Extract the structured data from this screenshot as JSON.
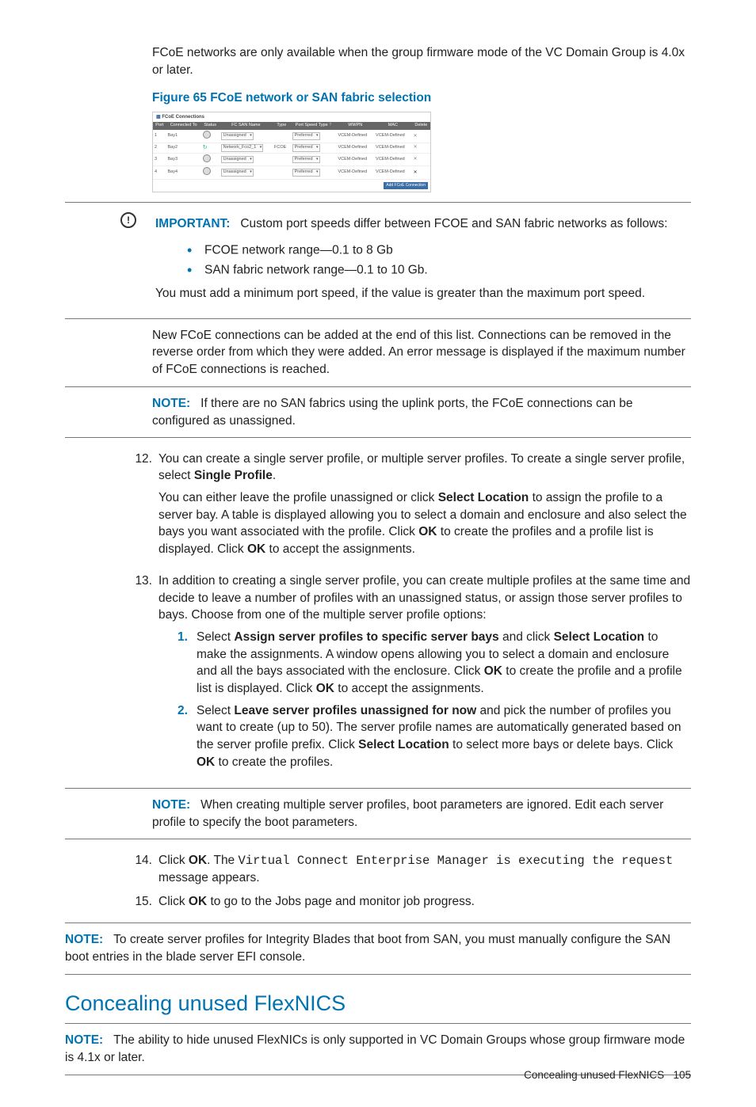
{
  "intro": "FCoE networks are only available when the group firmware mode of the VC Domain Group is 4.0x or later.",
  "figure": {
    "caption": "Figure 65 FCoE network or SAN fabric selection",
    "panel_title": "FCoE Connections",
    "headers": [
      "Port",
      "Connected To",
      "Status",
      "FC SAN Name",
      "Type",
      "Port Speed Type",
      "WWPN",
      "MAC",
      "Delete"
    ],
    "rows": [
      {
        "port": "1",
        "conn": "Bay1",
        "san": "Unassigned",
        "type": "",
        "speed": "Preferred",
        "wwpn": "VCEM-Defined",
        "mac": "VCEM-Defined"
      },
      {
        "port": "2",
        "conn": "Bay2",
        "san": "Network_Fco2_1",
        "type": "FCOE",
        "speed": "Preferred",
        "wwpn": "VCEM-Defined",
        "mac": "VCEM-Defined"
      },
      {
        "port": "3",
        "conn": "Bay3",
        "san": "Unassigned",
        "type": "",
        "speed": "Preferred",
        "wwpn": "VCEM-Defined",
        "mac": "VCEM-Defined"
      },
      {
        "port": "4",
        "conn": "Bay4",
        "san": "Unassigned",
        "type": "",
        "speed": "Preferred",
        "wwpn": "VCEM-Defined",
        "mac": "VCEM-Defined"
      }
    ],
    "button": "Add FCoE Connection"
  },
  "important": {
    "label": "IMPORTANT:",
    "lead": "Custom port speeds differ between FCOE and SAN fabric networks as follows:",
    "bullet1": "FCOE network range—0.1 to 8 Gb",
    "bullet2": "SAN fabric network range—0.1 to 10 Gb.",
    "tail": "You must add a minimum port speed, if the value is greater than the maximum port speed."
  },
  "para_new": "New FCoE connections can be added at the end of this list. Connections can be removed in the reverse order from which they were added. An error message is displayed if the maximum number of FCoE connections is reached.",
  "note1": {
    "label": "NOTE:",
    "text": "If there are no SAN fabrics using the uplink ports, the FCoE connections can be configured as unassigned."
  },
  "step12": {
    "num": "12.",
    "p1a": "You can create a single server profile, or multiple server profiles. To create a single server profile, select ",
    "p1b": "Single Profile",
    "p1c": ".",
    "p2a": "You can either leave the profile unassigned or click ",
    "p2b": "Select Location",
    "p2c": " to assign the profile to a server bay. A table is displayed allowing you to select a domain and enclosure and also select the bays you want associated with the profile. Click ",
    "p2d": "OK",
    "p2e": " to create the profiles and a profile list is displayed. Click ",
    "p2f": "OK",
    "p2g": " to accept the assignments."
  },
  "step13": {
    "num": "13.",
    "intro": "In addition to creating a single server profile, you can create multiple profiles at the same time and decide to leave a number of profiles with an unassigned status, or assign those server profiles to bays. Choose from one of the multiple server profile options:",
    "s1num": "1.",
    "s1a": "Select ",
    "s1b": "Assign server profiles to specific server bays",
    "s1c": " and click ",
    "s1d": "Select Location",
    "s1e": " to make the assignments. A window opens allowing you to select a domain and enclosure and all the bays associated with the enclosure. Click ",
    "s1f": "OK",
    "s1g": " to create the profile and a profile list is displayed. Click ",
    "s1h": "OK",
    "s1i": " to accept the assignments.",
    "s2num": "2.",
    "s2a": "Select ",
    "s2b": "Leave server profiles unassigned for now",
    "s2c": " and pick the number of profiles you want to create (up to 50). The server profile names are automatically generated based on the server profile prefix. Click ",
    "s2d": "Select Location",
    "s2e": " to select more bays or delete bays. Click ",
    "s2f": "OK",
    "s2g": " to create the profiles."
  },
  "note2": {
    "label": "NOTE:",
    "text": "When creating multiple server profiles, boot parameters are ignored. Edit each server profile to specify the boot parameters."
  },
  "step14": {
    "num": "14.",
    "a": "Click ",
    "b": "OK",
    "c": ". The ",
    "d": "Virtual Connect Enterprise Manager is executing the request",
    "e": " message appears."
  },
  "step15": {
    "num": "15.",
    "a": "Click ",
    "b": "OK",
    "c": " to go to the Jobs page and monitor job progress."
  },
  "note3": {
    "label": "NOTE:",
    "text": "To create server profiles for Integrity Blades that boot from SAN, you must manually configure the SAN boot entries in the blade server EFI console."
  },
  "h2": "Concealing unused FlexNICS",
  "note4": {
    "label": "NOTE:",
    "text": "The ability to hide unused FlexNICs is only supported in VC Domain Groups whose group firmware mode is 4.1x or later."
  },
  "footer": {
    "text": "Concealing unused FlexNICS",
    "page": "105"
  }
}
